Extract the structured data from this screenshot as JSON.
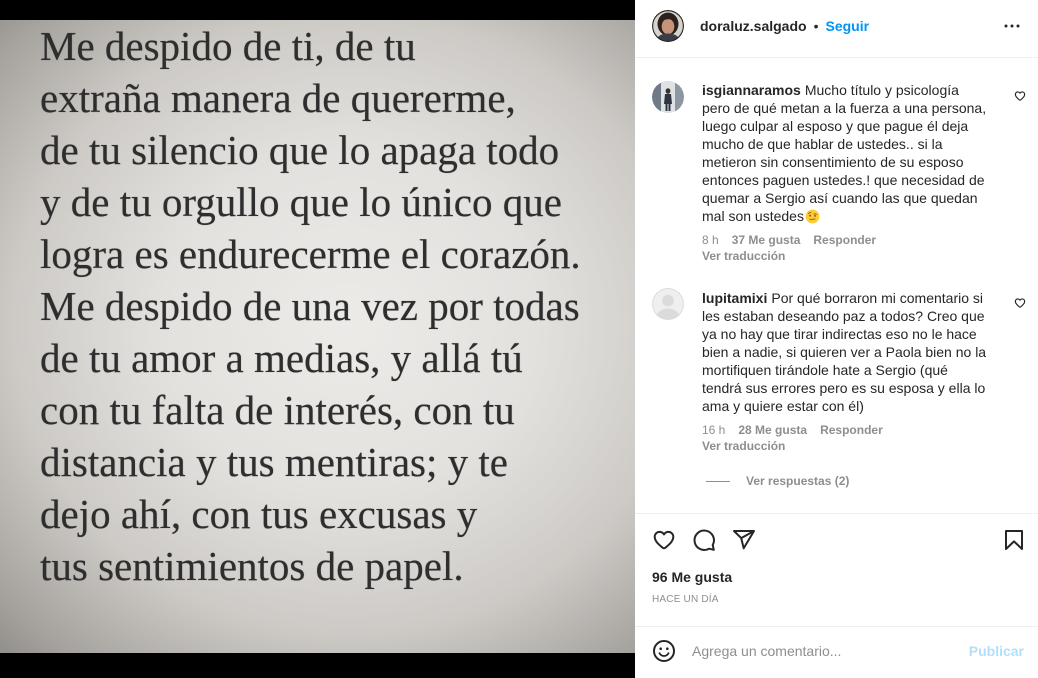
{
  "post_image": {
    "text_lines": [
      "Me despido de ti, de tu",
      "extraña manera de quererme,",
      "de tu silencio que lo apaga todo",
      "y de tu orgullo que lo único que",
      "logra es endurecerme el corazón.",
      "Me despido de una vez por todas",
      "de tu amor a medias, y allá tú",
      "con tu falta de interés, con tu",
      "distancia y tus mentiras; y te",
      "dejo ahí, con tus excusas y",
      "tus sentimientos de papel."
    ]
  },
  "header": {
    "username": "doraluz.salgado",
    "separator": "•",
    "follow_label": "Seguir",
    "more_icon": "more-options-icon"
  },
  "comments": [
    {
      "username": "isgiannaramos",
      "lines": [
        "Mucho título y psicología",
        "pero de qué metan a la fuerza a una persona,",
        "luego culpar al esposo y que pague él deja",
        "mucho de que hablar de ustedes.. si la",
        "metieron sin consentimiento de su esposo",
        "entonces paguen ustedes.! que necesidad de",
        "quemar a Sergio así cuando las que quedan",
        "mal son ustedes"
      ],
      "trailing_emoji_icon": "face-with-raised-eyebrow-icon",
      "time": "8 h",
      "likes": "37 Me gusta",
      "reply_label": "Responder",
      "translate_label": "Ver traducción",
      "like_icon": "heart-outline-icon"
    },
    {
      "username": "lupitamixi",
      "lines": [
        "Por qué borraron mi comentario si",
        "les estaban deseando paz a todos? Creo que",
        "ya no hay que tirar indirectas eso no le hace",
        "bien a nadie, si quieren ver a Paola bien no la",
        "mortifiquen tirándole hate a Sergio (qué",
        "tendrá sus errores pero es su esposa y ella lo",
        "ama y quiere estar con él)"
      ],
      "time": "16 h",
      "likes": "28 Me gusta",
      "reply_label": "Responder",
      "translate_label": "Ver traducción",
      "view_replies_label": "Ver respuestas (2)",
      "like_icon": "heart-outline-icon"
    }
  ],
  "actions": {
    "icons": [
      "heart-outline-icon",
      "comment-icon",
      "share-icon",
      "bookmark-icon"
    ]
  },
  "likes_count": "96 Me gusta",
  "timestamp": "HACE UN DÍA",
  "comment_box": {
    "emoji_icon": "smiley-icon",
    "placeholder": "Agrega un comentario...",
    "publish_label": "Publicar"
  },
  "colors": {
    "text": "#262626",
    "secondary_text": "#8e8e8e",
    "accent_blue": "#0095f6",
    "publish_disabled": "#b2dffc",
    "divider": "#efefef",
    "media_background": "#000000"
  }
}
